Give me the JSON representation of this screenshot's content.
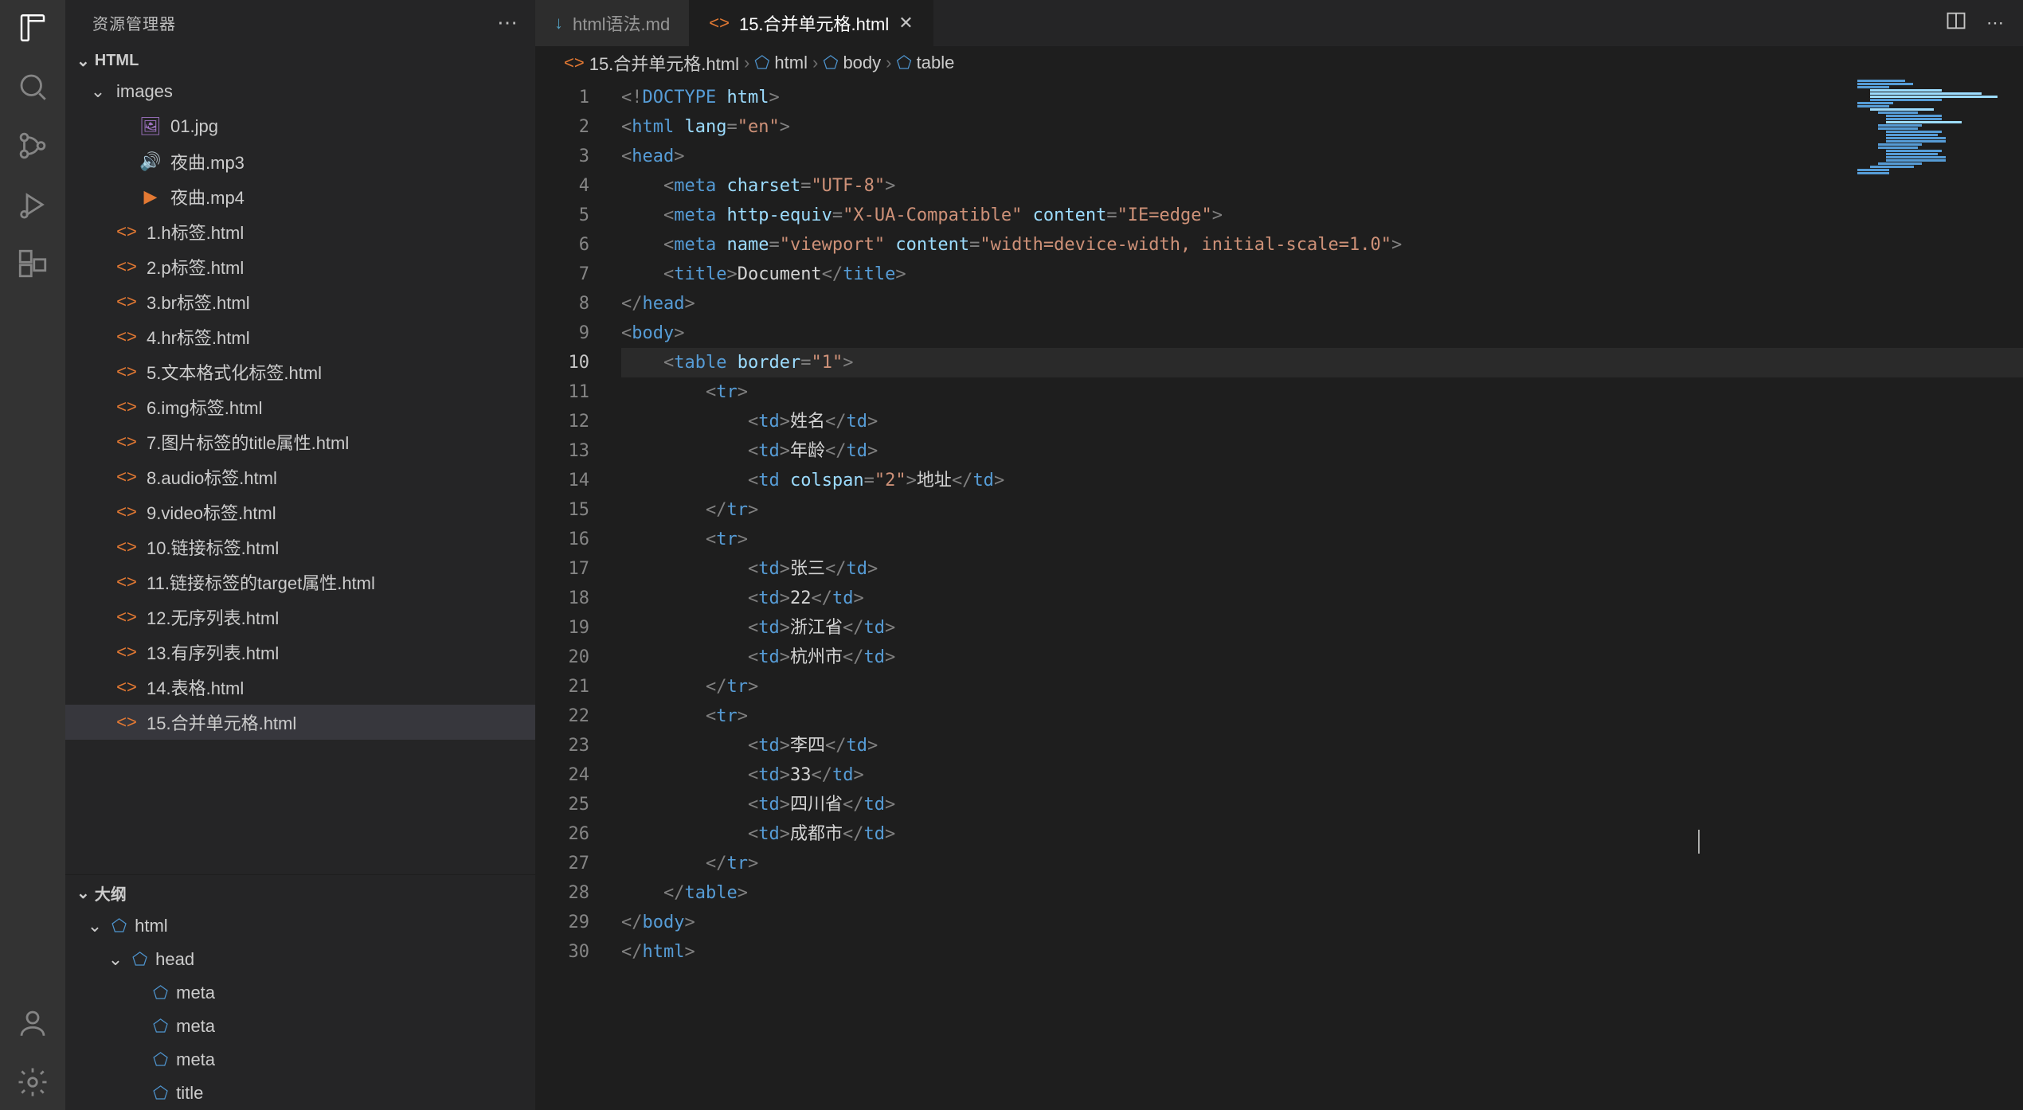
{
  "sidebar": {
    "title": "资源管理器",
    "root": "HTML",
    "folder_images": "images",
    "files_images": [
      "01.jpg",
      "夜曲.mp3",
      "夜曲.mp4"
    ],
    "files": [
      "1.h标签.html",
      "2.p标签.html",
      "3.br标签.html",
      "4.hr标签.html",
      "5.文本格式化标签.html",
      "6.img标签.html",
      "7.图片标签的title属性.html",
      "8.audio标签.html",
      "9.video标签.html",
      "10.链接标签.html",
      "11.链接标签的target属性.html",
      "12.无序列表.html",
      "13.有序列表.html",
      "14.表格.html",
      "15.合并单元格.html"
    ],
    "selected": "15.合并单元格.html"
  },
  "outline": {
    "title": "大纲",
    "items": [
      "html",
      "head",
      "meta",
      "meta",
      "meta",
      "title"
    ]
  },
  "tabs": [
    {
      "label": "html语法.md",
      "icon": "md",
      "active": false
    },
    {
      "label": "15.合并单元格.html",
      "icon": "html",
      "active": true
    }
  ],
  "breadcrumb": [
    "15.合并单元格.html",
    "html",
    "body",
    "table"
  ],
  "editor": {
    "current_line": 10,
    "lines": 30,
    "tokens": [
      [
        [
          "mbr",
          "<!"
        ],
        [
          "doct",
          "DOCTYPE"
        ],
        [
          "txt",
          " "
        ],
        [
          "attr",
          "html"
        ],
        [
          "mbr",
          ">"
        ]
      ],
      [
        [
          "mbr",
          "<"
        ],
        [
          "tag",
          "html"
        ],
        [
          "txt",
          " "
        ],
        [
          "attr",
          "lang"
        ],
        [
          "mbr",
          "="
        ],
        [
          "str",
          "\"en\""
        ],
        [
          "mbr",
          ">"
        ]
      ],
      [
        [
          "mbr",
          "<"
        ],
        [
          "tag",
          "head"
        ],
        [
          "mbr",
          ">"
        ]
      ],
      [
        [
          "txt",
          "    "
        ],
        [
          "mbr",
          "<"
        ],
        [
          "tag",
          "meta"
        ],
        [
          "txt",
          " "
        ],
        [
          "attr",
          "charset"
        ],
        [
          "mbr",
          "="
        ],
        [
          "str",
          "\"UTF-8\""
        ],
        [
          "mbr",
          ">"
        ]
      ],
      [
        [
          "txt",
          "    "
        ],
        [
          "mbr",
          "<"
        ],
        [
          "tag",
          "meta"
        ],
        [
          "txt",
          " "
        ],
        [
          "attr",
          "http-equiv"
        ],
        [
          "mbr",
          "="
        ],
        [
          "str",
          "\"X-UA-Compatible\""
        ],
        [
          "txt",
          " "
        ],
        [
          "attr",
          "content"
        ],
        [
          "mbr",
          "="
        ],
        [
          "str",
          "\"IE=edge\""
        ],
        [
          "mbr",
          ">"
        ]
      ],
      [
        [
          "txt",
          "    "
        ],
        [
          "mbr",
          "<"
        ],
        [
          "tag",
          "meta"
        ],
        [
          "txt",
          " "
        ],
        [
          "attr",
          "name"
        ],
        [
          "mbr",
          "="
        ],
        [
          "str",
          "\"viewport\""
        ],
        [
          "txt",
          " "
        ],
        [
          "attr",
          "content"
        ],
        [
          "mbr",
          "="
        ],
        [
          "str",
          "\"width=device-width, initial-scale=1.0\""
        ],
        [
          "mbr",
          ">"
        ]
      ],
      [
        [
          "txt",
          "    "
        ],
        [
          "mbr",
          "<"
        ],
        [
          "tag",
          "title"
        ],
        [
          "mbr",
          ">"
        ],
        [
          "txt",
          "Document"
        ],
        [
          "mbr",
          "</"
        ],
        [
          "tag",
          "title"
        ],
        [
          "mbr",
          ">"
        ]
      ],
      [
        [
          "mbr",
          "</"
        ],
        [
          "tag",
          "head"
        ],
        [
          "mbr",
          ">"
        ]
      ],
      [
        [
          "mbr",
          "<"
        ],
        [
          "tag",
          "body"
        ],
        [
          "mbr",
          ">"
        ]
      ],
      [
        [
          "txt",
          "    "
        ],
        [
          "mbr",
          "<"
        ],
        [
          "tag",
          "table"
        ],
        [
          "txt",
          " "
        ],
        [
          "attr",
          "border"
        ],
        [
          "mbr",
          "="
        ],
        [
          "str",
          "\"1\""
        ],
        [
          "mbr",
          ">"
        ]
      ],
      [
        [
          "txt",
          "        "
        ],
        [
          "mbr",
          "<"
        ],
        [
          "tag",
          "tr"
        ],
        [
          "mbr",
          ">"
        ]
      ],
      [
        [
          "txt",
          "            "
        ],
        [
          "mbr",
          "<"
        ],
        [
          "tag",
          "td"
        ],
        [
          "mbr",
          ">"
        ],
        [
          "txt",
          "姓名"
        ],
        [
          "mbr",
          "</"
        ],
        [
          "tag",
          "td"
        ],
        [
          "mbr",
          ">"
        ]
      ],
      [
        [
          "txt",
          "            "
        ],
        [
          "mbr",
          "<"
        ],
        [
          "tag",
          "td"
        ],
        [
          "mbr",
          ">"
        ],
        [
          "txt",
          "年龄"
        ],
        [
          "mbr",
          "</"
        ],
        [
          "tag",
          "td"
        ],
        [
          "mbr",
          ">"
        ]
      ],
      [
        [
          "txt",
          "            "
        ],
        [
          "mbr",
          "<"
        ],
        [
          "tag",
          "td"
        ],
        [
          "txt",
          " "
        ],
        [
          "attr",
          "colspan"
        ],
        [
          "mbr",
          "="
        ],
        [
          "str",
          "\"2\""
        ],
        [
          "mbr",
          ">"
        ],
        [
          "txt",
          "地址"
        ],
        [
          "mbr",
          "</"
        ],
        [
          "tag",
          "td"
        ],
        [
          "mbr",
          ">"
        ]
      ],
      [
        [
          "txt",
          "        "
        ],
        [
          "mbr",
          "</"
        ],
        [
          "tag",
          "tr"
        ],
        [
          "mbr",
          ">"
        ]
      ],
      [
        [
          "txt",
          "        "
        ],
        [
          "mbr",
          "<"
        ],
        [
          "tag",
          "tr"
        ],
        [
          "mbr",
          ">"
        ]
      ],
      [
        [
          "txt",
          "            "
        ],
        [
          "mbr",
          "<"
        ],
        [
          "tag",
          "td"
        ],
        [
          "mbr",
          ">"
        ],
        [
          "txt",
          "张三"
        ],
        [
          "mbr",
          "</"
        ],
        [
          "tag",
          "td"
        ],
        [
          "mbr",
          ">"
        ]
      ],
      [
        [
          "txt",
          "            "
        ],
        [
          "mbr",
          "<"
        ],
        [
          "tag",
          "td"
        ],
        [
          "mbr",
          ">"
        ],
        [
          "txt",
          "22"
        ],
        [
          "mbr",
          "</"
        ],
        [
          "tag",
          "td"
        ],
        [
          "mbr",
          ">"
        ]
      ],
      [
        [
          "txt",
          "            "
        ],
        [
          "mbr",
          "<"
        ],
        [
          "tag",
          "td"
        ],
        [
          "mbr",
          ">"
        ],
        [
          "txt",
          "浙江省"
        ],
        [
          "mbr",
          "</"
        ],
        [
          "tag",
          "td"
        ],
        [
          "mbr",
          ">"
        ]
      ],
      [
        [
          "txt",
          "            "
        ],
        [
          "mbr",
          "<"
        ],
        [
          "tag",
          "td"
        ],
        [
          "mbr",
          ">"
        ],
        [
          "txt",
          "杭州市"
        ],
        [
          "mbr",
          "</"
        ],
        [
          "tag",
          "td"
        ],
        [
          "mbr",
          ">"
        ]
      ],
      [
        [
          "txt",
          "        "
        ],
        [
          "mbr",
          "</"
        ],
        [
          "tag",
          "tr"
        ],
        [
          "mbr",
          ">"
        ]
      ],
      [
        [
          "txt",
          "        "
        ],
        [
          "mbr",
          "<"
        ],
        [
          "tag",
          "tr"
        ],
        [
          "mbr",
          ">"
        ]
      ],
      [
        [
          "txt",
          "            "
        ],
        [
          "mbr",
          "<"
        ],
        [
          "tag",
          "td"
        ],
        [
          "mbr",
          ">"
        ],
        [
          "txt",
          "李四"
        ],
        [
          "mbr",
          "</"
        ],
        [
          "tag",
          "td"
        ],
        [
          "mbr",
          ">"
        ]
      ],
      [
        [
          "txt",
          "            "
        ],
        [
          "mbr",
          "<"
        ],
        [
          "tag",
          "td"
        ],
        [
          "mbr",
          ">"
        ],
        [
          "txt",
          "33"
        ],
        [
          "mbr",
          "</"
        ],
        [
          "tag",
          "td"
        ],
        [
          "mbr",
          ">"
        ]
      ],
      [
        [
          "txt",
          "            "
        ],
        [
          "mbr",
          "<"
        ],
        [
          "tag",
          "td"
        ],
        [
          "mbr",
          ">"
        ],
        [
          "txt",
          "四川省"
        ],
        [
          "mbr",
          "</"
        ],
        [
          "tag",
          "td"
        ],
        [
          "mbr",
          ">"
        ]
      ],
      [
        [
          "txt",
          "            "
        ],
        [
          "mbr",
          "<"
        ],
        [
          "tag",
          "td"
        ],
        [
          "mbr",
          ">"
        ],
        [
          "txt",
          "成都市"
        ],
        [
          "mbr",
          "</"
        ],
        [
          "tag",
          "td"
        ],
        [
          "mbr",
          ">"
        ]
      ],
      [
        [
          "txt",
          "        "
        ],
        [
          "mbr",
          "</"
        ],
        [
          "tag",
          "tr"
        ],
        [
          "mbr",
          ">"
        ]
      ],
      [
        [
          "txt",
          "    "
        ],
        [
          "mbr",
          "</"
        ],
        [
          "tag",
          "table"
        ],
        [
          "mbr",
          ">"
        ]
      ],
      [
        [
          "mbr",
          "</"
        ],
        [
          "tag",
          "body"
        ],
        [
          "mbr",
          ">"
        ]
      ],
      [
        [
          "mbr",
          "</"
        ],
        [
          "tag",
          "html"
        ],
        [
          "mbr",
          ">"
        ]
      ]
    ]
  }
}
